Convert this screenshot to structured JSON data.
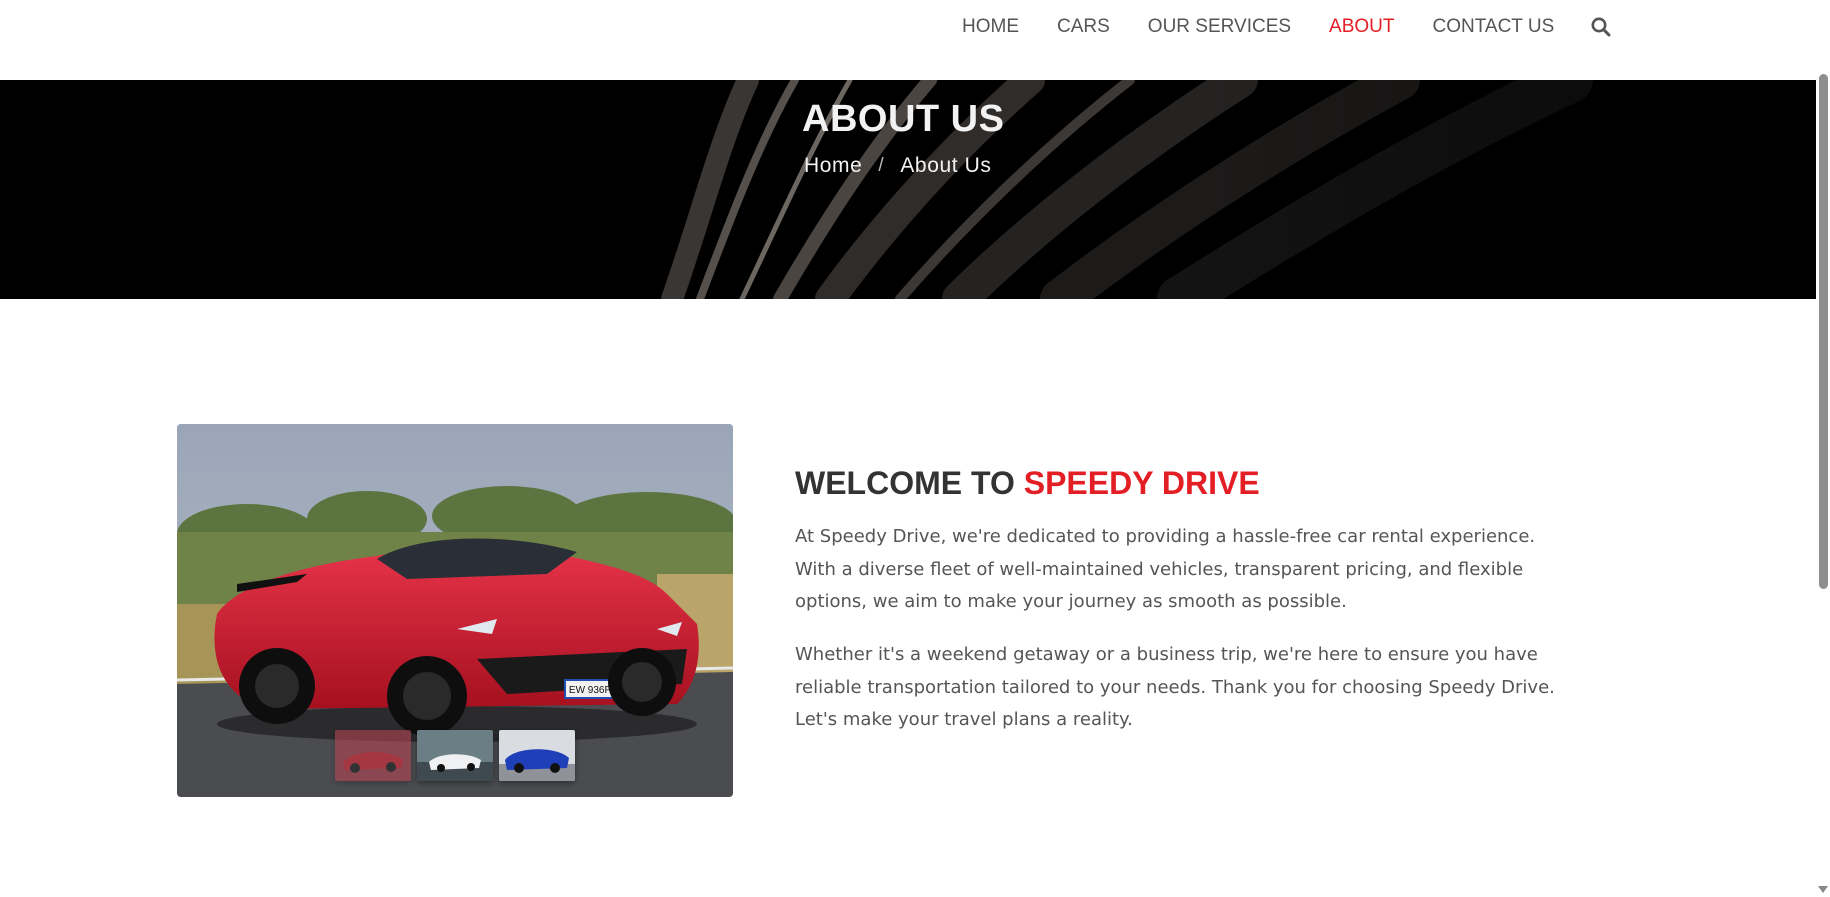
{
  "nav": {
    "items": [
      {
        "label": "HOME",
        "active": false
      },
      {
        "label": "CARS",
        "active": false
      },
      {
        "label": "OUR SERVICES",
        "active": false
      },
      {
        "label": "ABOUT",
        "active": true
      },
      {
        "label": "CONTACT US",
        "active": false
      }
    ],
    "search_icon": "search-icon"
  },
  "hero": {
    "title": "ABOUT US",
    "breadcrumb": {
      "home": "Home",
      "separator": "/",
      "current": "About Us"
    }
  },
  "about": {
    "heading_prefix": "WELCOME TO",
    "heading_brand": "SPEEDY DRIVE",
    "paragraph1": "At Speedy Drive, we're dedicated to providing a hassle-free car rental experience. With a diverse fleet of well-maintained vehicles, transparent pricing, and flexible options, we aim to make your journey as smooth as possible.",
    "paragraph2": "Whether it's a weekend getaway or a business trip, we're here to ensure you have reliable transportation tailored to your needs. Thank you for choosing Speedy Drive. Let's make your travel plans a reality.",
    "plate": "EW 936PA"
  },
  "colors": {
    "accent": "#e31e24",
    "hero_bg": "#000000",
    "text": "#333333",
    "nav_text": "#555555"
  }
}
